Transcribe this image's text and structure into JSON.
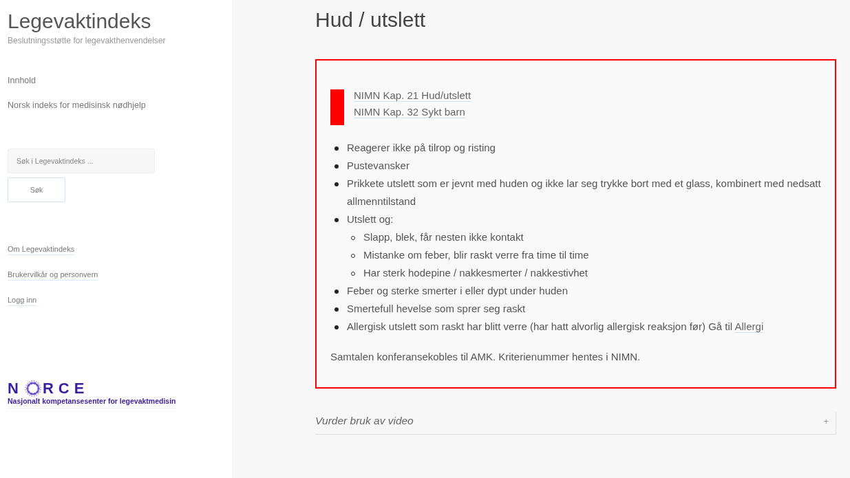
{
  "sidebar": {
    "site_title": "Legevaktindeks",
    "tagline": "Beslutningsstøtte for legevakthenvendelser",
    "nav": [
      "Innhold",
      "Norsk indeks for medisinsk nødhjelp"
    ],
    "search": {
      "placeholder": "Søk i Legevaktindeks ...",
      "button": "Søk"
    },
    "links": [
      "Om Legevaktindeks",
      "Brukervilkår og personvern",
      "Logg inn"
    ],
    "logo": {
      "letters_before": "N",
      "letters_after": "RCE",
      "subtitle": "Nasjonalt kompetansesenter for legevaktmedisin"
    }
  },
  "main": {
    "title": "Hud / utslett",
    "alert": {
      "color": "#ff0000",
      "references": [
        "NIMN Kap. 21 Hud/utslett",
        "NIMN Kap. 32 Sykt barn"
      ],
      "criteria": [
        {
          "text": "Reagerer ikke på tilrop og risting"
        },
        {
          "text": "Pustevansker"
        },
        {
          "text": "Prikkete utslett som er jevnt med huden og ikke lar seg trykke bort med et glass, kombinert med nedsatt allmenntilstand"
        },
        {
          "text": "Utslett og:",
          "children": [
            {
              "text": "Slapp, blek, får nesten ikke kontakt"
            },
            {
              "text": "Mistanke om feber, blir raskt verre fra time til time"
            },
            {
              "text": "Har sterk hodepine / nakkesmerter / nakkestivhet"
            }
          ]
        },
        {
          "text": "Feber og sterke smerter i eller dypt under huden"
        },
        {
          "text": "Smertefull hevelse som sprer seg raskt"
        },
        {
          "text": "Allergisk utslett som raskt har blitt verre (har hatt alvorlig allergisk reaksjon før) Gå til",
          "link": "Allergi"
        }
      ],
      "note": "Samtalen konferansekobles til AMK. Kriterienummer hentes i NIMN."
    },
    "accordion": [
      {
        "title": "Vurder bruk av video",
        "toggle": "+",
        "expanded": false
      }
    ]
  }
}
